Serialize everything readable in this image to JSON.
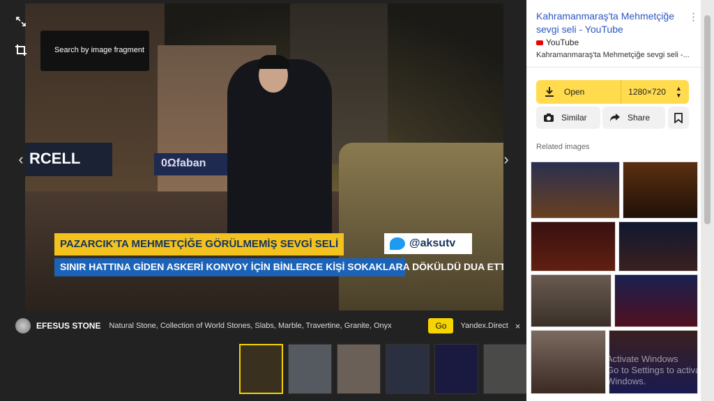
{
  "viewer": {
    "tooltip": "Search by image fragment",
    "image": {
      "sign_left": "RCELL",
      "sign_mid": "0Ωfaban",
      "caption_top": "PAZARCIK'TA MEHMETÇİĞE GÖRÜLMEMİŞ SEVGİ SELİ",
      "caption_bottom": "SINIR HATTINA GİDEN ASKERİ KONVOY İÇİN BİNLERCE KİŞİ SOKAKLARA DÖKÜLDÜ DUA ETTİ",
      "twitter_handle": "@aksutv"
    },
    "ad": {
      "brand": "EFESUS STONE",
      "description": "Natural Stone, Collection of World Stones, Slabs, Marble, Travertine, Granite, Onyx",
      "cta": "Go",
      "source": "Yandex.Direct",
      "close": "×"
    },
    "thumbnails_colors": [
      "#3a3020",
      "#555a60",
      "#6a6058",
      "#2a3040",
      "#1a1a40",
      "#4a4a48"
    ]
  },
  "sidebar": {
    "title": "Kahramanmaraş'ta Mehmetçiğe sevgi seli - YouTube",
    "source": "YouTube",
    "subtitle": "Kahramanmaraş'ta Mehmetçiğe sevgi seli -...",
    "open_label": "Open",
    "resolution": "1280×720",
    "similar_label": "Similar",
    "share_label": "Share",
    "related_label": "Related images"
  },
  "watermark": {
    "line1": "Activate Windows",
    "line2": "Go to Settings to activate Windows."
  },
  "colors": {
    "accent_yellow": "#ffdb4d",
    "link_blue": "#2b56c3",
    "caption_yellow": "#f4c21e",
    "caption_blue": "#1b63b8"
  }
}
